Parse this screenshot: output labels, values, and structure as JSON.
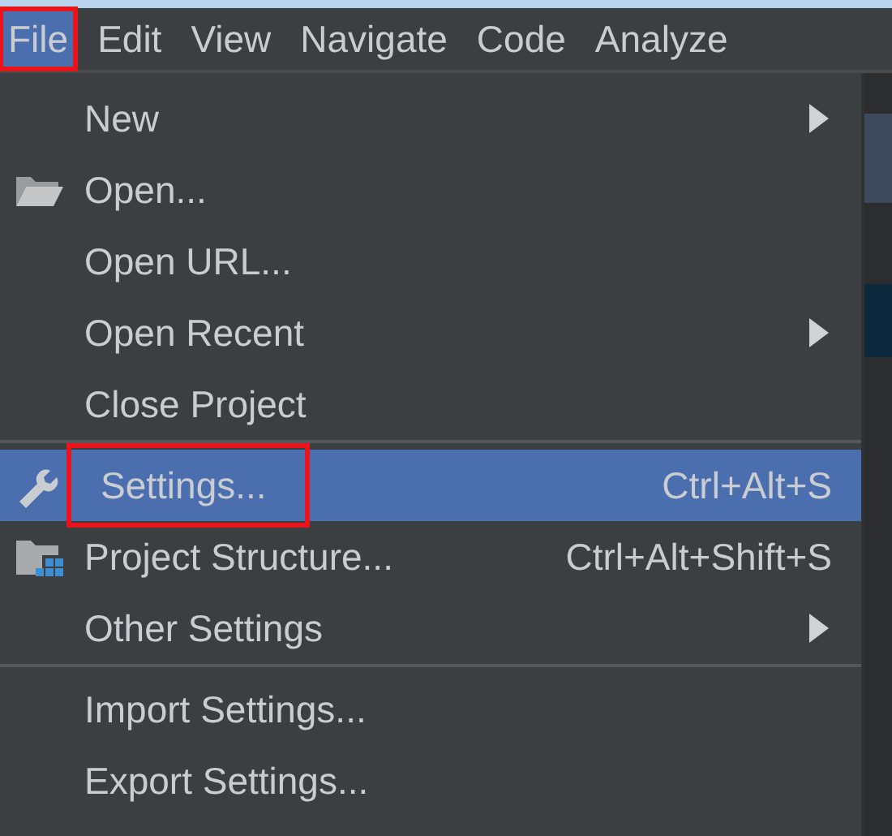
{
  "menu_bar": [
    {
      "label": "File",
      "selected": true,
      "highlighted": true
    },
    {
      "label": "Edit",
      "selected": false,
      "highlighted": false
    },
    {
      "label": "View",
      "selected": false,
      "highlighted": false
    },
    {
      "label": "Navigate",
      "selected": false,
      "highlighted": false
    },
    {
      "label": "Code",
      "selected": false,
      "highlighted": false
    },
    {
      "label": "Analyze",
      "selected": false,
      "highlighted": false
    }
  ],
  "file_menu": {
    "groups": [
      [
        {
          "label": "New",
          "kind": "plain",
          "submenu": true,
          "selected": false,
          "highlighted": false
        },
        {
          "label": "Open...",
          "kind": "folder",
          "submenu": false,
          "selected": false,
          "highlighted": false
        },
        {
          "label": "Open URL...",
          "kind": "plain",
          "submenu": false,
          "selected": false,
          "highlighted": false
        },
        {
          "label": "Open Recent",
          "kind": "plain",
          "submenu": true,
          "selected": false,
          "highlighted": false
        },
        {
          "label": "Close Project",
          "kind": "plain",
          "submenu": false,
          "selected": false,
          "highlighted": false
        }
      ],
      [
        {
          "label": "Settings...",
          "kind": "wrench",
          "shortcut": "Ctrl+Alt+S",
          "submenu": false,
          "selected": true,
          "highlighted": true
        },
        {
          "label": "Project Structure...",
          "kind": "structure",
          "shortcut": "Ctrl+Alt+Shift+S",
          "submenu": false,
          "selected": false,
          "highlighted": false
        },
        {
          "label": "Other Settings",
          "kind": "plain",
          "submenu": true,
          "selected": false,
          "highlighted": false
        }
      ],
      [
        {
          "label": "Import Settings...",
          "kind": "plain",
          "submenu": false,
          "selected": false,
          "highlighted": false
        },
        {
          "label": "Export Settings...",
          "kind": "plain",
          "submenu": false,
          "selected": false,
          "highlighted": false
        }
      ]
    ]
  }
}
